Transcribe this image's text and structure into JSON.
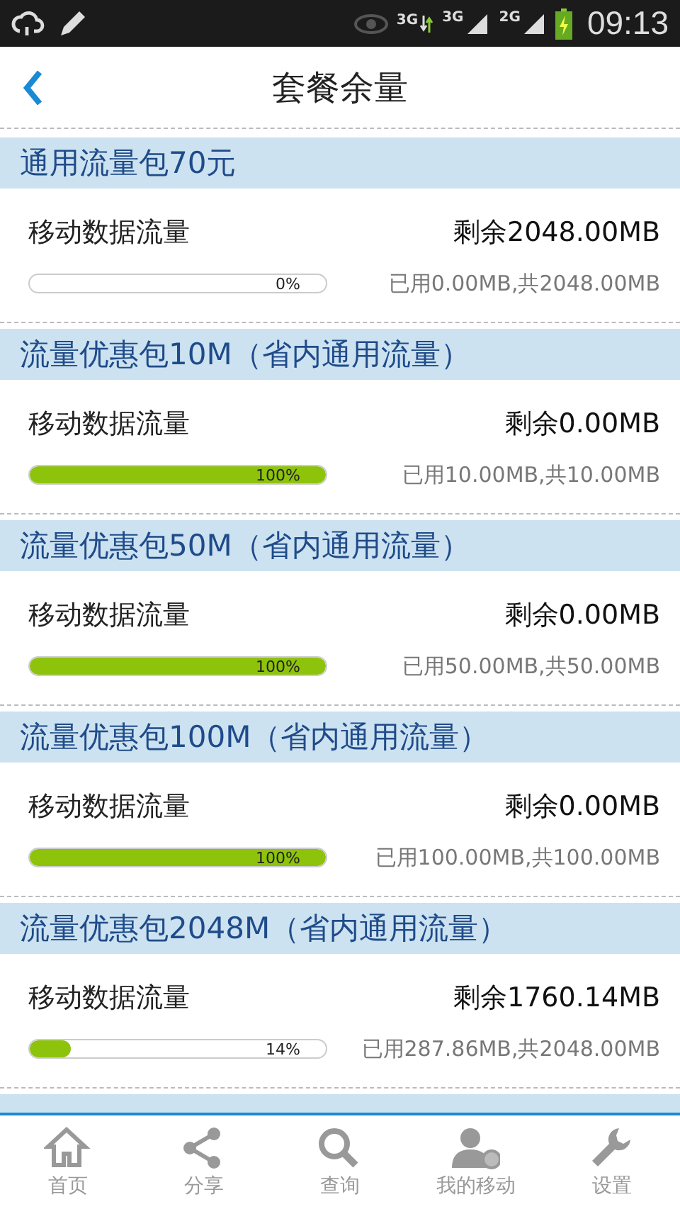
{
  "status_bar": {
    "network_labels": [
      "3G",
      "3G",
      "2G"
    ],
    "time": "09:13"
  },
  "header": {
    "title": "套餐余量"
  },
  "packages": [
    {
      "name": "通用流量包70元",
      "items": [
        {
          "label": "移动数据流量",
          "remaining": "剩余2048.00MB",
          "level": 0,
          "percent": "0%",
          "usage": "已用0.00MB,共2048.00MB"
        }
      ]
    },
    {
      "name": "流量优惠包10M（省内通用流量）",
      "items": [
        {
          "label": "移动数据流量",
          "remaining": "剩余0.00MB",
          "level": 1,
          "percent": "100%",
          "usage": "已用10.00MB,共10.00MB"
        }
      ]
    },
    {
      "name": "流量优惠包50M（省内通用流量）",
      "items": [
        {
          "label": "移动数据流量",
          "remaining": "剩余0.00MB",
          "level": 1,
          "percent": "100%",
          "usage": "已用50.00MB,共50.00MB"
        }
      ]
    },
    {
      "name": "流量优惠包100M（省内通用流量）",
      "items": [
        {
          "label": "移动数据流量",
          "remaining": "剩余0.00MB",
          "level": 1,
          "percent": "100%",
          "usage": "已用100.00MB,共100.00MB"
        }
      ]
    },
    {
      "name": "流量优惠包2048M（省内通用流量）",
      "items": [
        {
          "label": "移动数据流量",
          "remaining": "剩余1760.14MB",
          "level": 0.14,
          "percent": "14%",
          "usage": "已用287.86MB,共2048.00MB"
        }
      ]
    }
  ],
  "nav": [
    {
      "label": "首页"
    },
    {
      "label": "分享"
    },
    {
      "label": "查询"
    },
    {
      "label": "我的移动"
    },
    {
      "label": "设置"
    }
  ]
}
